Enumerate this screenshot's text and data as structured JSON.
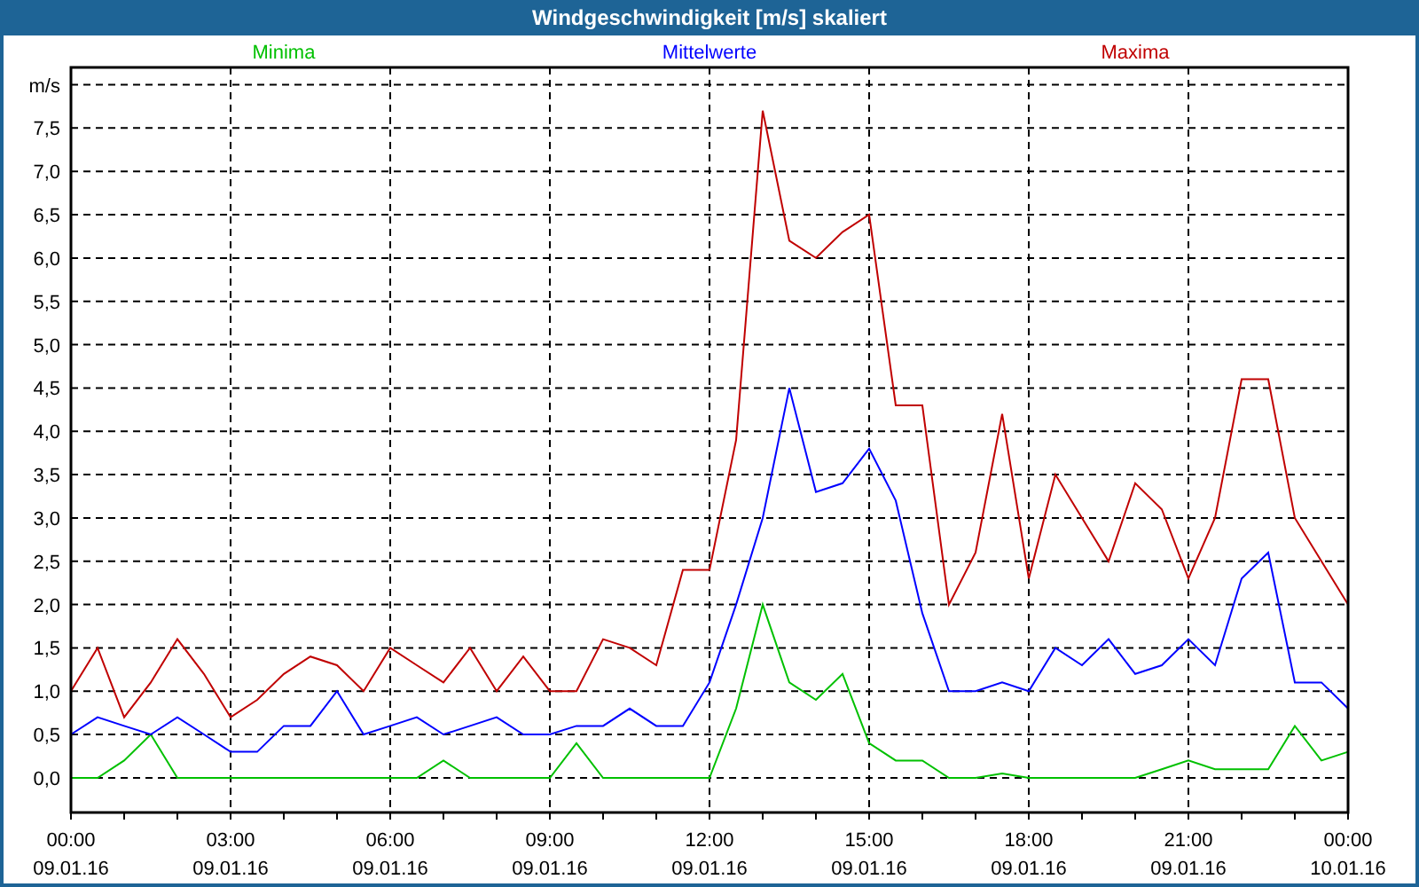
{
  "window": {
    "title": "Windgeschwindigkeit [m/s] skaliert"
  },
  "chart": {
    "chart_data": {
      "type": "line",
      "ylabel": "m/s",
      "categories": [
        "00:00 09.01.16",
        null,
        null,
        null,
        null,
        null,
        "03:00 09.01.16",
        null,
        null,
        null,
        null,
        null,
        "06:00 09.01.16",
        null,
        null,
        null,
        null,
        null,
        "09:00 09.01.16",
        null,
        null,
        null,
        null,
        null,
        "12:00 09.01.16",
        null,
        null,
        null,
        null,
        null,
        "15:00 09.01.16",
        null,
        null,
        null,
        null,
        null,
        "18:00 09.01.16",
        null,
        null,
        null,
        null,
        null,
        "21:00 09.01.16",
        null,
        null,
        null,
        null,
        null,
        "00:00 10.01.16"
      ],
      "ylim": [
        -0.4,
        8.2
      ],
      "grid": true,
      "yticks": [
        {
          "value": 0,
          "label": "0,0"
        },
        {
          "value": 0.5,
          "label": "0,5"
        },
        {
          "value": 1,
          "label": "1,0"
        },
        {
          "value": 1.5,
          "label": "1,5"
        },
        {
          "value": 2,
          "label": "2,0"
        },
        {
          "value": 2.5,
          "label": "2,5"
        },
        {
          "value": 3,
          "label": "3,0"
        },
        {
          "value": 3.5,
          "label": "3,5"
        },
        {
          "value": 4,
          "label": "4,0"
        },
        {
          "value": 4.5,
          "label": "4,5"
        },
        {
          "value": 5,
          "label": "5,0"
        },
        {
          "value": 5.5,
          "label": "5,5"
        },
        {
          "value": 6,
          "label": "6,0"
        },
        {
          "value": 6.5,
          "label": "6,5"
        },
        {
          "value": 7,
          "label": "7,0"
        },
        {
          "value": 7.5,
          "label": "7,5"
        }
      ],
      "series": [
        {
          "name": "Minima",
          "color": "#00c000",
          "values": [
            0,
            0,
            0.2,
            0.5,
            0,
            0,
            0,
            0,
            0,
            0,
            0,
            0,
            0,
            0,
            0.2,
            0,
            0,
            0,
            0,
            0.4,
            0,
            0,
            0,
            0,
            0,
            0.8,
            2.0,
            1.1,
            0.9,
            1.2,
            0.4,
            0.2,
            0.2,
            0,
            0,
            0.05,
            0,
            0,
            0,
            0,
            0,
            0.1,
            0.2,
            0.1,
            0.1,
            0.1,
            0.6,
            0.2,
            0.3
          ]
        },
        {
          "name": "Mittelwerte",
          "color": "#0000ff",
          "values": [
            0.5,
            0.7,
            0.6,
            0.5,
            0.7,
            0.5,
            0.3,
            0.3,
            0.6,
            0.6,
            1.0,
            0.5,
            0.6,
            0.7,
            0.5,
            0.6,
            0.7,
            0.5,
            0.5,
            0.6,
            0.6,
            0.8,
            0.6,
            0.6,
            1.1,
            2.0,
            3.0,
            4.5,
            3.3,
            3.4,
            3.8,
            3.2,
            1.9,
            1.0,
            1.0,
            1.1,
            1.0,
            1.5,
            1.3,
            1.6,
            1.2,
            1.3,
            1.6,
            1.3,
            2.3,
            2.6,
            1.1,
            1.1,
            0.8
          ]
        },
        {
          "name": "Maxima",
          "color": "#c00000",
          "values": [
            1.0,
            1.5,
            0.7,
            1.1,
            1.6,
            1.2,
            0.7,
            0.9,
            1.2,
            1.4,
            1.3,
            1.0,
            1.5,
            1.3,
            1.1,
            1.5,
            1.0,
            1.4,
            1.0,
            1.0,
            1.6,
            1.5,
            1.3,
            2.4,
            2.4,
            3.9,
            7.7,
            6.2,
            6.0,
            6.3,
            6.5,
            4.3,
            4.3,
            2.0,
            2.6,
            4.2,
            2.3,
            3.5,
            3.0,
            2.5,
            3.4,
            3.1,
            2.3,
            3.0,
            4.6,
            4.6,
            3.0,
            2.5,
            2.0
          ]
        }
      ]
    }
  }
}
